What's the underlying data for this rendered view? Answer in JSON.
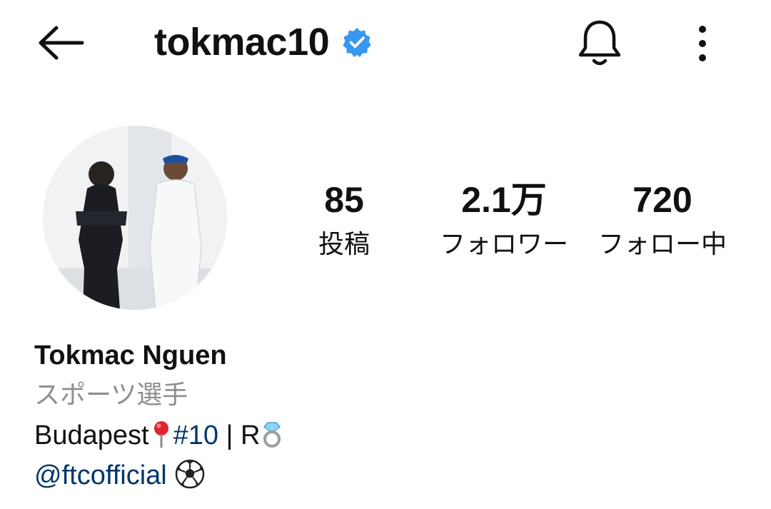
{
  "header": {
    "username": "tokmac10",
    "verified": true,
    "verified_color": "#3897f0",
    "icons": [
      "back-arrow-icon",
      "verified-badge-icon",
      "bell-icon",
      "more-vertical-icon"
    ]
  },
  "profile": {
    "stats": {
      "posts_value": "85",
      "posts_label": "投稿",
      "followers_value": "2.1万",
      "followers_label": "フォロワー",
      "following_value": "720",
      "following_label": "フォロー中"
    },
    "full_name": "Tokmac Nguen",
    "category": "スポーツ選手",
    "bio": {
      "text_before": "Budapest",
      "pin_emoji": "pushpin-icon",
      "hashtag": "#10",
      "separator": " | R",
      "ring_emoji": "ring-icon"
    },
    "mention": "@ftcofficial",
    "mention_emoji": "soccer-ball-icon",
    "link_color": "#00376b",
    "secondary_text_color": "#8e8e8e"
  }
}
